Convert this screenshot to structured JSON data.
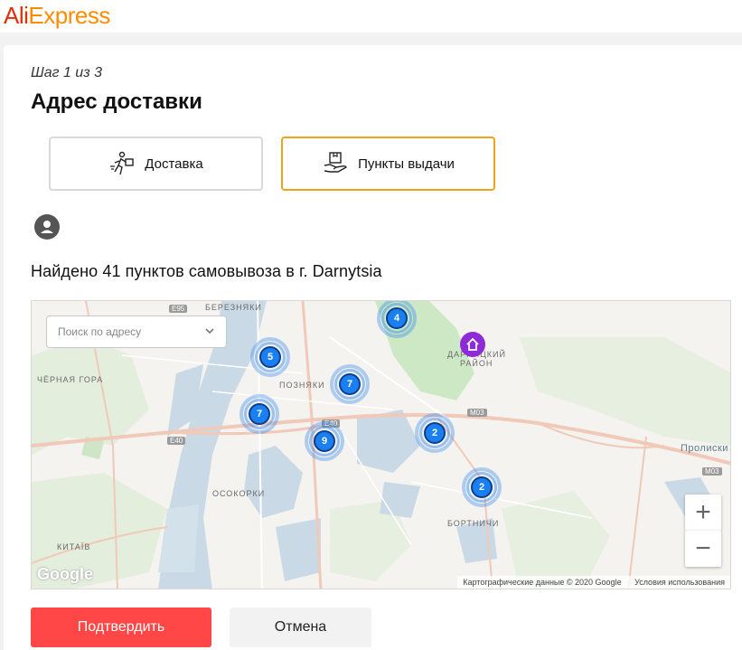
{
  "brand": {
    "part1": "Ali",
    "part2": "Express"
  },
  "step": "Шаг 1 из 3",
  "title": "Адрес доставки",
  "tabs": [
    {
      "label": "Доставка",
      "icon": "courier-icon",
      "active": false
    },
    {
      "label": "Пункты выдачи",
      "icon": "parcel-hand-icon",
      "active": true
    }
  ],
  "found_text": "Найдено 41 пунктов самовывоза в г. Darnytsia",
  "map": {
    "search_placeholder": "Поиск по адресу",
    "labels": {
      "berezniaky": "БЕРЕЗНЯКИ",
      "chorna_hora": "ЧЁРНАЯ ГОРА",
      "pozniaky": "ПОЗНЯКИ",
      "darnytskyi": "ДАРНИЦКИЙ",
      "raion": "РАЙОН",
      "osokorky": "ОСОКОРКИ",
      "bortnychi": "БОРТНИЧИ",
      "kytaiv": "КИТАЇВ",
      "proliski": "Пролиски"
    },
    "roads": {
      "e95": "E95",
      "e40a": "E40",
      "e40b": "E40",
      "m03a": "M03",
      "m03b": "M03"
    },
    "clusters": [
      "4",
      "5",
      "7",
      "7",
      "9",
      "2",
      "2"
    ],
    "zoom_in": "+",
    "zoom_out": "−",
    "google": "Google",
    "attribution": "Картографические данные © 2020 Google",
    "terms": "Условия использования"
  },
  "buttons": {
    "confirm": "Подтвердить",
    "cancel": "Отмена"
  },
  "colors": {
    "accent": "#f0a21b",
    "confirm": "#ff4747",
    "cluster": "#1a7ff0",
    "home": "#8e2bd6"
  }
}
